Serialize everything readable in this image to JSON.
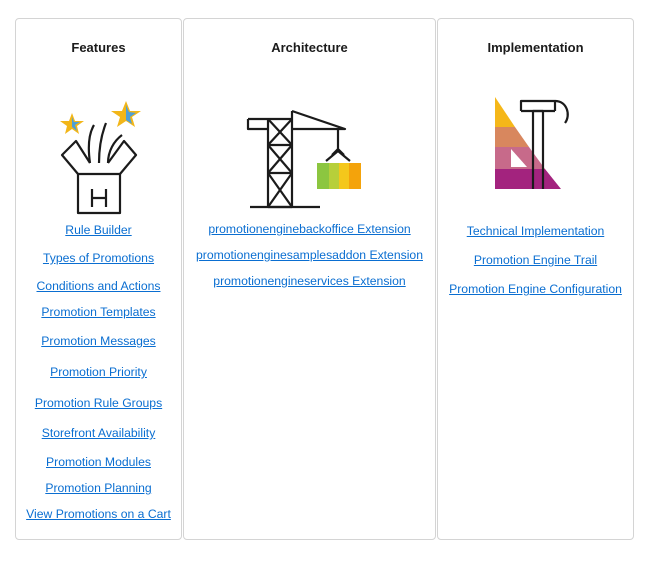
{
  "features": {
    "title": "Features",
    "links": [
      "Rule Builder",
      "Types of Promotions",
      "Conditions and Actions",
      "Promotion Templates",
      "Promotion Messages",
      "Promotion Priority",
      "Promotion Rule Groups",
      "Storefront Availability",
      "Promotion Modules",
      "Promotion Planning",
      "View Promotions on a Cart"
    ]
  },
  "architecture": {
    "title": "Architecture",
    "links": [
      "promotionenginebackoffice Extension",
      "promotionenginesamplesaddon Extension",
      "promotionengineservices Extension"
    ]
  },
  "implementation": {
    "title": "Implementation",
    "links": [
      "Technical Implementation",
      "Promotion Engine Trail",
      "Promotion Engine Configuration"
    ]
  },
  "colors": {
    "link": "#0a6ed1",
    "star_yellow": "#f2b619",
    "star_blue": "#4f9fd6",
    "crane_green": "#8cc640",
    "crane_orange": "#f4a30b",
    "ruler_yellow": "#f5b719",
    "ruler_magenta": "#a3237e"
  }
}
